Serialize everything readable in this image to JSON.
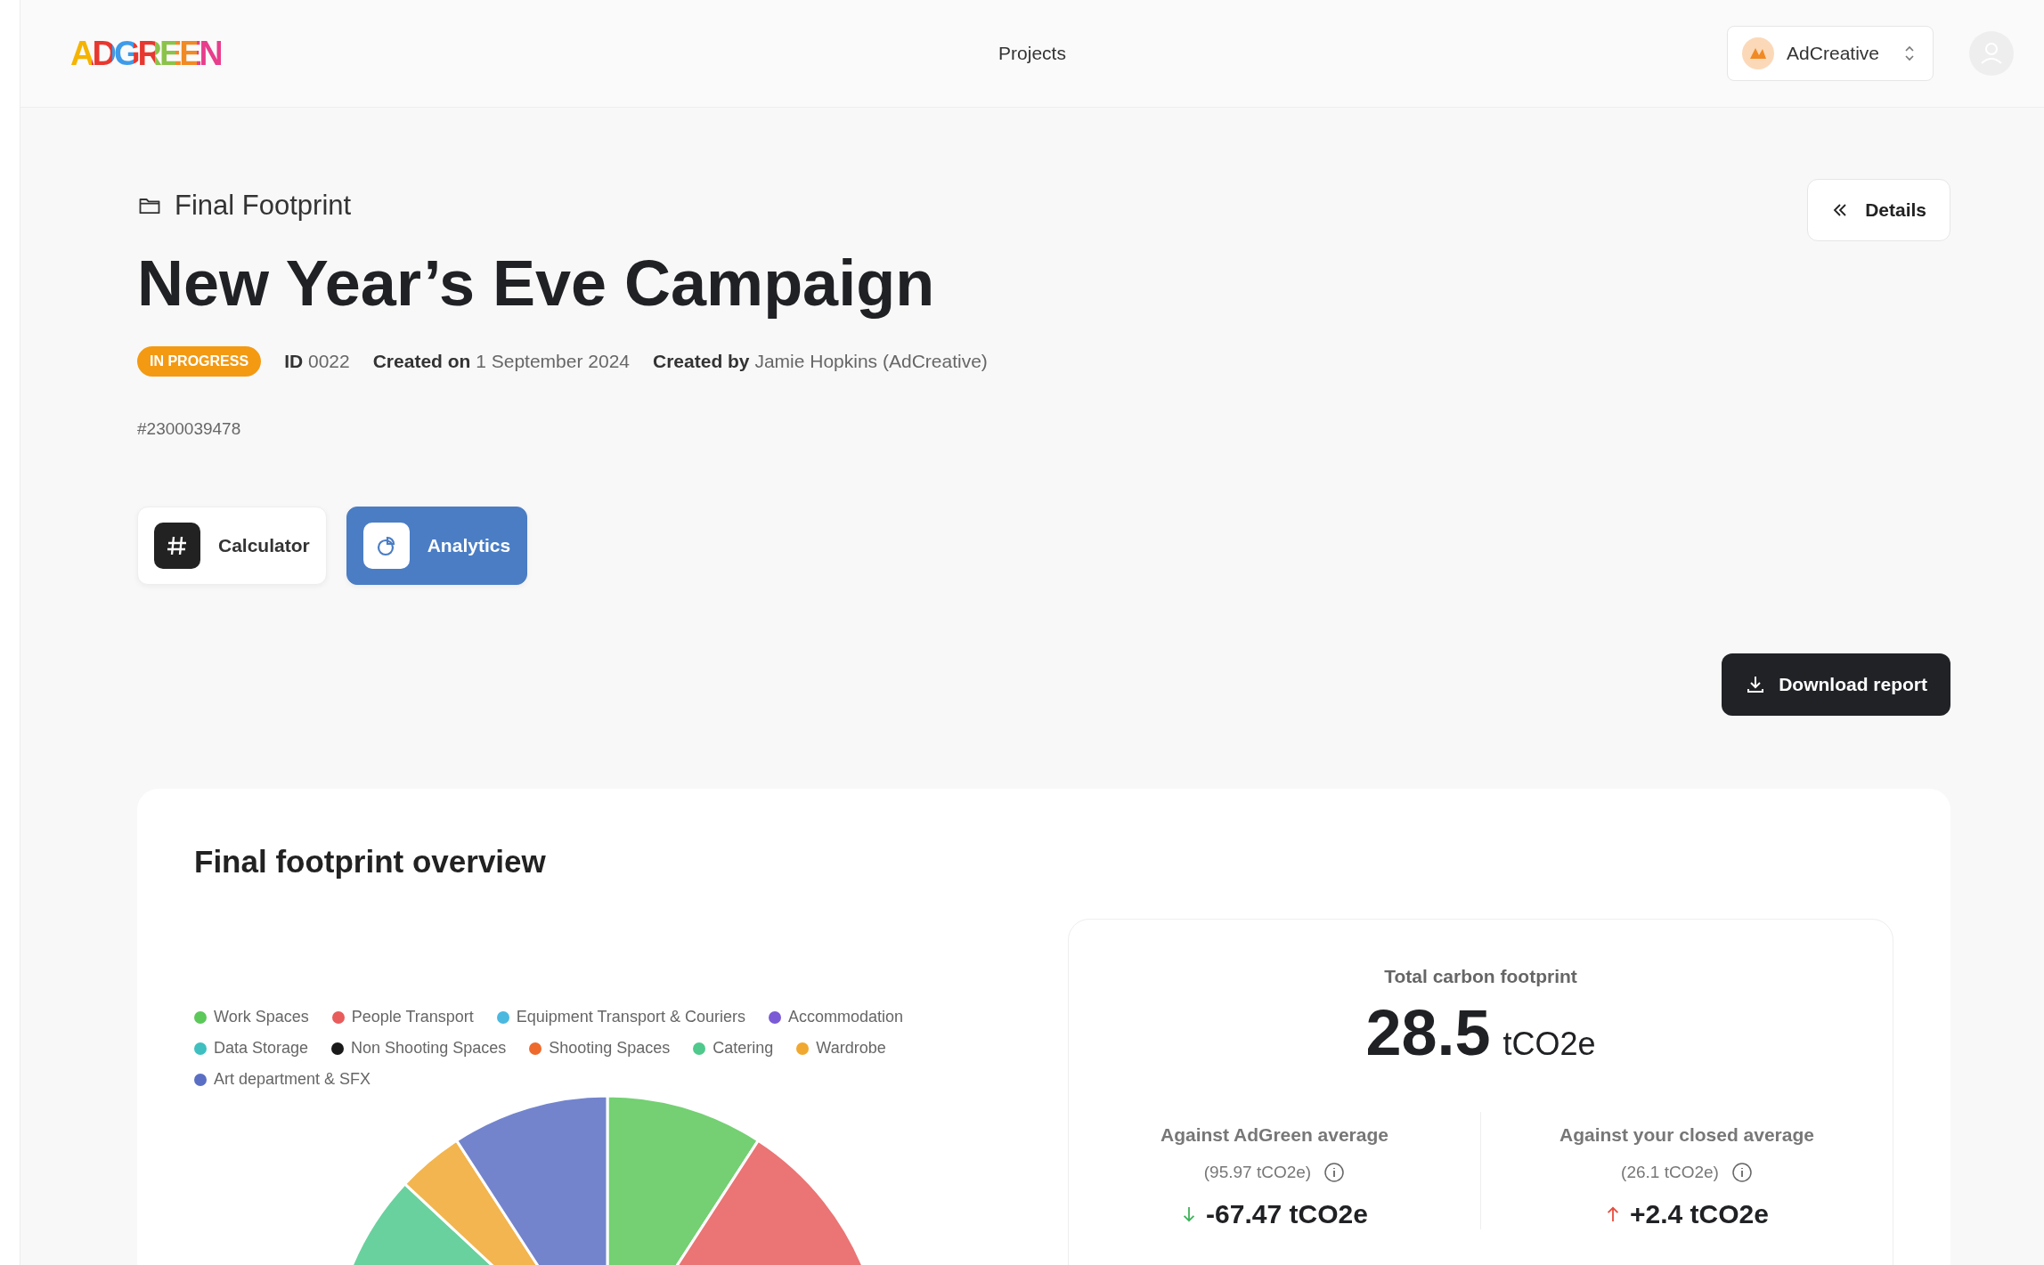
{
  "header": {
    "logo": "ADGREEN",
    "nav": [
      {
        "label": "Projects"
      }
    ],
    "workspace": {
      "name": "AdCreative"
    }
  },
  "breadcrumb": "Final Footprint",
  "title": "New Year’s Eve Campaign",
  "details_button": "Details",
  "status_badge": "IN PROGRESS",
  "meta": [
    "**ID** 0022",
    "**Created on** 1 September 2024",
    "**Created by** Jamie Hopkins (AdCreative)"
  ],
  "reference": "#2300039478",
  "tabs": [
    {
      "label": "Calculator",
      "selected": false,
      "kind": "calculator"
    },
    {
      "label": "Analytics",
      "selected": true,
      "kind": "analytics"
    }
  ],
  "download_button": "Download report",
  "overview": {
    "title": "Final footprint overview",
    "legend": [
      {
        "label": "Work Spaces",
        "color": "#5cc85a"
      },
      {
        "label": "People Transport",
        "color": "#e85c5c"
      },
      {
        "label": "Equipment Transport & Couriers",
        "color": "#4bb8e0"
      },
      {
        "label": "Accommodation",
        "color": "#7b5ad6"
      },
      {
        "label": "Data Storage",
        "color": "#3fbfbf"
      },
      {
        "label": "Non Shooting Spaces",
        "color": "#1a1a1a"
      },
      {
        "label": "Shooting Spaces",
        "color": "#ee6a2c"
      },
      {
        "label": "Catering",
        "color": "#4fc98c"
      },
      {
        "label": "Wardrobe",
        "color": "#f0a830"
      },
      {
        "label": "Art department & SFX",
        "color": "#5a6fc4"
      }
    ],
    "total": {
      "label": "Total carbon footprint",
      "value": "28.5",
      "unit": "tCO2e"
    },
    "comparisons": [
      {
        "label": "Against AdGreen average",
        "reference": "(95.97 tCO2e)",
        "delta": "-67.47 tCO2e",
        "kind": "decrease"
      },
      {
        "label": "Against your closed average",
        "reference": "(26.1 tCO2e)",
        "delta": "+2.4 tCO2e",
        "kind": "increase"
      }
    ]
  }
}
